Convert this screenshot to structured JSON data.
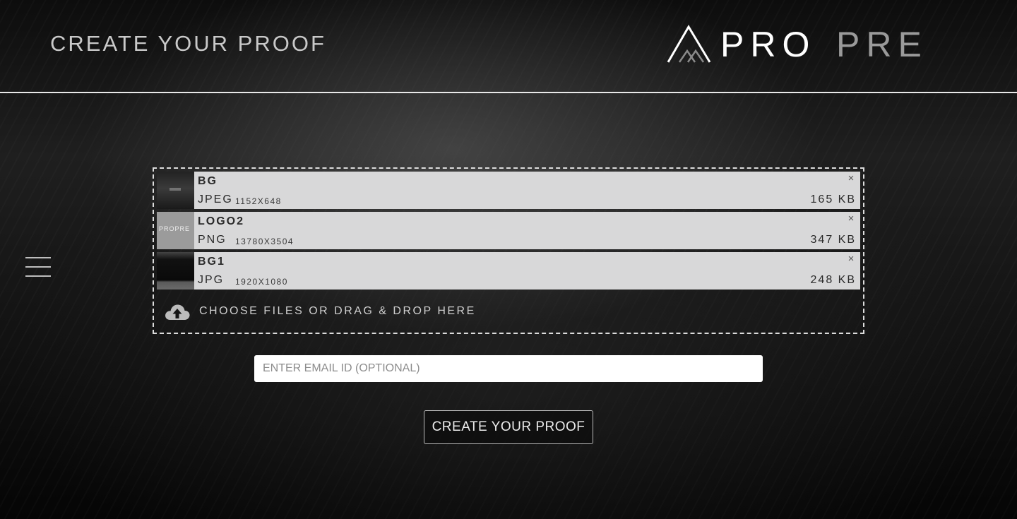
{
  "header": {
    "title": "CREATE YOUR PROOF",
    "logo": {
      "text_primary": "PRO",
      "text_secondary": "PRE",
      "colors": {
        "primary": "#ffffff",
        "secondary": "#9a9a9a"
      }
    }
  },
  "menu": {
    "icon": "hamburger-icon"
  },
  "upload": {
    "files": [
      {
        "name": "BG",
        "type": "JPEG",
        "dimensions": "1152X648",
        "size": "165 KB",
        "remove_label": "×"
      },
      {
        "name": "LOGO2",
        "type": "PNG",
        "dimensions": "13780X3504",
        "size": "347 KB",
        "remove_label": "×",
        "thumb_text": "PROPRE"
      },
      {
        "name": "BG1",
        "type": "JPG",
        "dimensions": "1920X1080",
        "size": "248 KB",
        "remove_label": "×"
      }
    ],
    "choose_label": "CHOOSE FILES OR DRAG & DROP HERE",
    "icon": "cloud-upload-icon"
  },
  "email": {
    "placeholder": "ENTER EMAIL ID (OPTIONAL)",
    "value": ""
  },
  "submit": {
    "label": "CREATE YOUR PROOF"
  },
  "colors": {
    "background": "#141414",
    "file_item_bg": "#d8d8d9",
    "text_light": "#cfcfcf",
    "divider": "#e8e8e8"
  }
}
